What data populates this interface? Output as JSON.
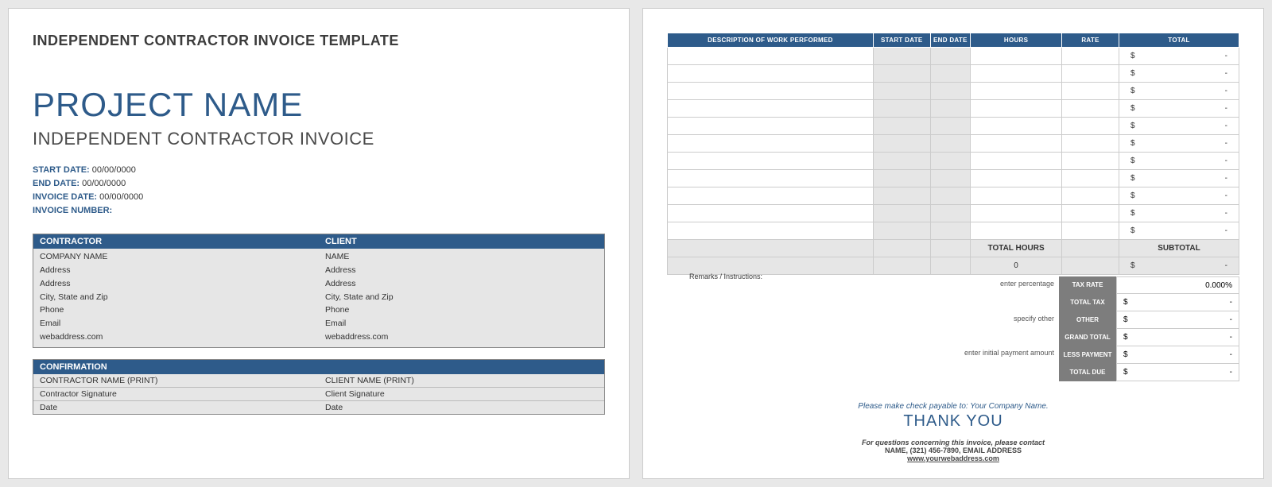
{
  "page1": {
    "template_title": "INDEPENDENT CONTRACTOR INVOICE TEMPLATE",
    "project_name": "PROJECT NAME",
    "subtitle": "INDEPENDENT CONTRACTOR INVOICE",
    "meta": {
      "start_label": "START DATE:",
      "start_val": "00/00/0000",
      "end_label": "END DATE:",
      "end_val": "00/00/0000",
      "inv_date_label": "INVOICE DATE:",
      "inv_date_val": "00/00/0000",
      "inv_num_label": "INVOICE NUMBER:",
      "inv_num_val": ""
    },
    "contractor": {
      "header": "CONTRACTOR",
      "rows": [
        "COMPANY NAME",
        "Address",
        "Address",
        "City, State and Zip",
        "Phone",
        "Email",
        "webaddress.com"
      ]
    },
    "client": {
      "header": "CLIENT",
      "rows": [
        "NAME",
        "Address",
        "Address",
        "City, State and Zip",
        "Phone",
        "Email",
        "webaddress.com"
      ]
    },
    "confirmation": {
      "header": "CONFIRMATION",
      "rows": [
        {
          "left": "CONTRACTOR NAME (PRINT)",
          "right": "CLIENT NAME (PRINT)"
        },
        {
          "left": "Contractor Signature",
          "right": "Client Signature"
        },
        {
          "left": "Date",
          "right": "Date"
        }
      ]
    }
  },
  "page2": {
    "columns": {
      "desc": "DESCRIPTION OF WORK PERFORMED",
      "start": "START DATE",
      "end": "END DATE",
      "hours": "HOURS",
      "rate": "RATE",
      "total": "TOTAL"
    },
    "row_count": 11,
    "currency": "$",
    "dash": "-",
    "summary": {
      "total_hours_label": "TOTAL HOURS",
      "total_hours_val": "0",
      "subtotal_label": "SUBTOTAL"
    },
    "calc": {
      "tax_hint": "enter percentage",
      "tax_label": "TAX RATE",
      "tax_val": "0.000%",
      "total_tax_label": "TOTAL TAX",
      "other_hint": "specify other",
      "other_label": "OTHER",
      "grand_label": "GRAND TOTAL",
      "less_hint": "enter initial payment amount",
      "less_label": "LESS PAYMENT",
      "due_label": "TOTAL DUE"
    },
    "remarks_label": "Remarks / Instructions:",
    "footer": {
      "pay": "Please make check payable to: Your Company Name.",
      "thanks": "THANK YOU",
      "contact1": "For questions concerning this invoice, please contact",
      "contact2": "NAME, (321) 456-7890, EMAIL ADDRESS",
      "web": "www.yourwebaddress.com"
    }
  }
}
